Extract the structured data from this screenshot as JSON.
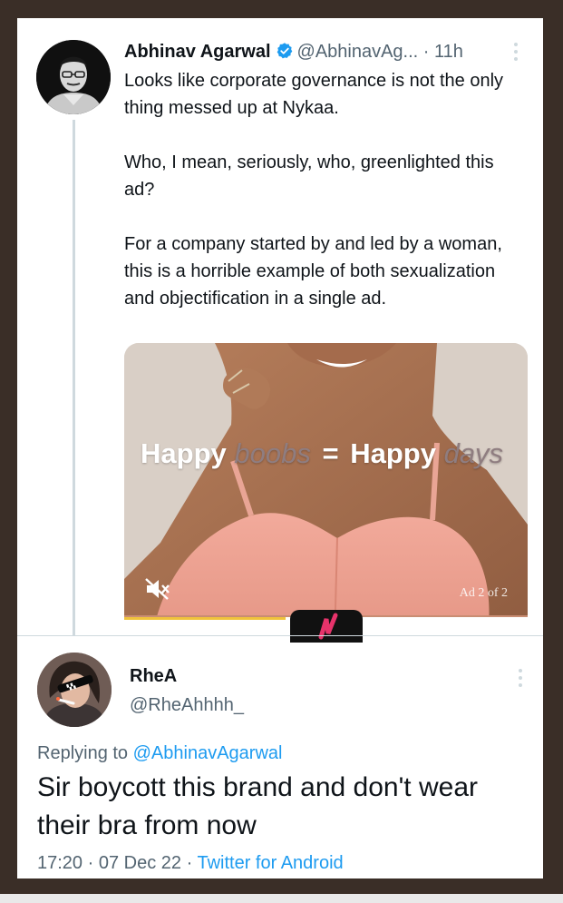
{
  "tweet": {
    "author_name": "Abhinav Agarwal",
    "handle": "@AbhinavAg...",
    "separator": "·",
    "time": "11h",
    "paragraphs": [
      "Looks like corporate governance is not the only thing messed up at Nykaa.",
      "Who, I mean, seriously, who, greenlighted this ad?",
      "For a company started by and led by a woman, this is a horrible example of both sexualization and objectification in a single ad."
    ],
    "media": {
      "overlay_word1": "Happy",
      "overlay_word2": "boobs",
      "overlay_eq": "=",
      "overlay_word3": "Happy",
      "overlay_word4": "days",
      "ad_counter": "Ad 2 of 2",
      "progress_fraction": 0.4
    }
  },
  "reply": {
    "author_name": "RheA",
    "handle": "@RheAhhhh_",
    "replying_prefix": "Replying to",
    "replying_to": "@AbhinavAgarwal",
    "text": "Sir boycott this brand and don't wear their bra from now",
    "time": "17:20",
    "dot1": "·",
    "date": "07 Dec 22",
    "dot2": "·",
    "source": "Twitter for Android"
  },
  "colors": {
    "background": "#3a2e27",
    "text_primary": "#0f1419",
    "text_secondary": "#536471",
    "link": "#1d9bf0",
    "verified": "#1d9bf0",
    "progress": "#f0c33c"
  },
  "icons": [
    "verified-badge-icon",
    "more-options-icon",
    "muted-speaker-icon",
    "brand-logo-icon"
  ]
}
